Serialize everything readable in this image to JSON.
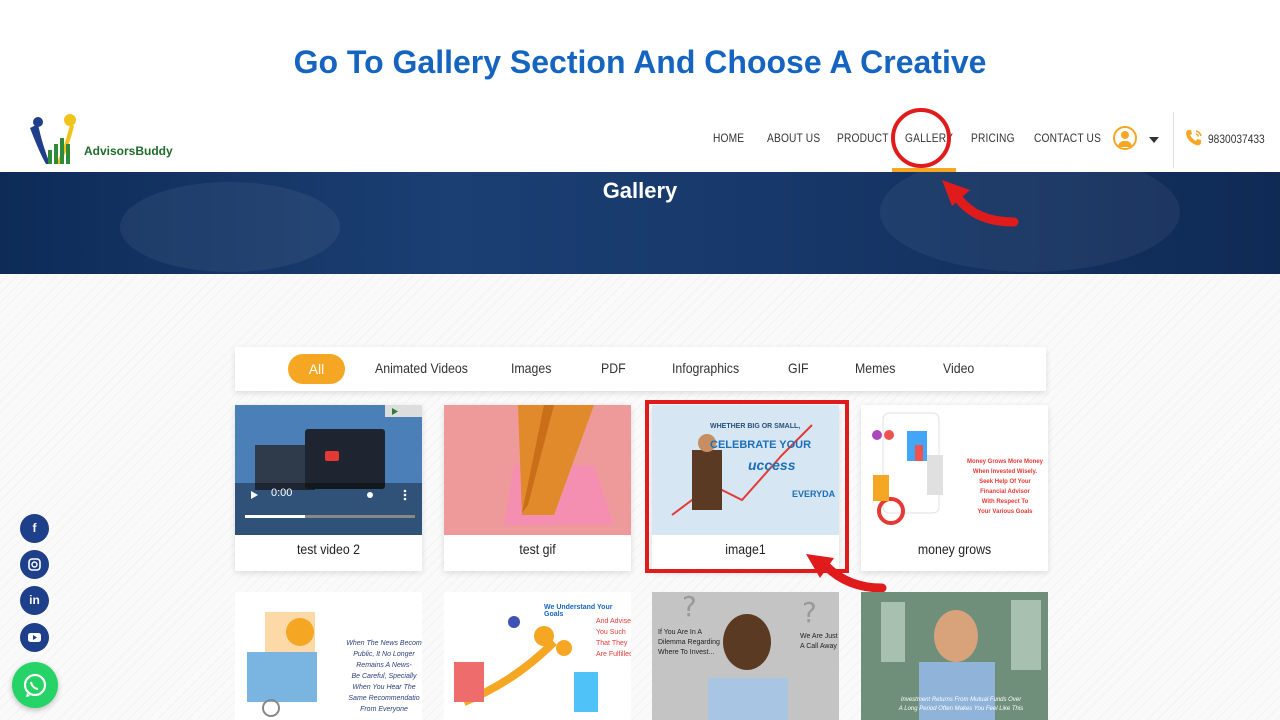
{
  "slide_title": "Go To Gallery Section And Choose A Creative",
  "brand": {
    "name": "AdvisorsBuddy"
  },
  "nav": {
    "items": [
      {
        "label": "HOME"
      },
      {
        "label": "ABOUT US"
      },
      {
        "label": "PRODUCT"
      },
      {
        "label": "GALLERY"
      },
      {
        "label": "PRICING"
      },
      {
        "label": "CONTACT US"
      }
    ],
    "phone": "9830037433"
  },
  "banner": {
    "title": "Gallery"
  },
  "filters": [
    "All",
    "Animated Videos",
    "Images",
    "PDF",
    "Infographics",
    "GIF",
    "Memes",
    "Video"
  ],
  "cards": [
    {
      "title": "test video 2",
      "video_time": "0:00"
    },
    {
      "title": "test gif"
    },
    {
      "title": "image1",
      "thumb_text": [
        "WHETHER BIG OR SMALL,",
        "CELEBRATE YOUR",
        "uccess",
        "EVERYDA"
      ]
    },
    {
      "title": "money grows",
      "thumb_text": [
        "Money Grows More Money",
        "When Invested Wisely.",
        "Seek Help Of Your",
        "Financial Advisor",
        "With Respect To",
        "Your Various Goals"
      ]
    }
  ],
  "row2": [
    {
      "thumb_text": [
        "When The News Becom",
        "Public, It No Longer",
        "Remains A News-",
        "Be Careful, Specially",
        "When You Hear The",
        "Same Recommendatio",
        "From Everyone"
      ]
    },
    {
      "thumb_text": [
        "We Understand Your Goals",
        "And Advise",
        "You Such",
        "That They",
        "Are Fulfilled"
      ]
    },
    {
      "thumb_text": [
        "If You Are In A",
        "Dilemma Regarding",
        "Where To Invest...",
        "We Are Just",
        "A Call Away"
      ]
    },
    {
      "thumb_text": [
        "Investment Returns From Mutual Funds Over",
        "A Long Period Often Makes You Feel Like This"
      ]
    }
  ],
  "colors": {
    "accent": "#f5a623",
    "title_blue": "#1565c0",
    "highlight_red": "#e01b1b",
    "banner_navy": "#17386a"
  }
}
